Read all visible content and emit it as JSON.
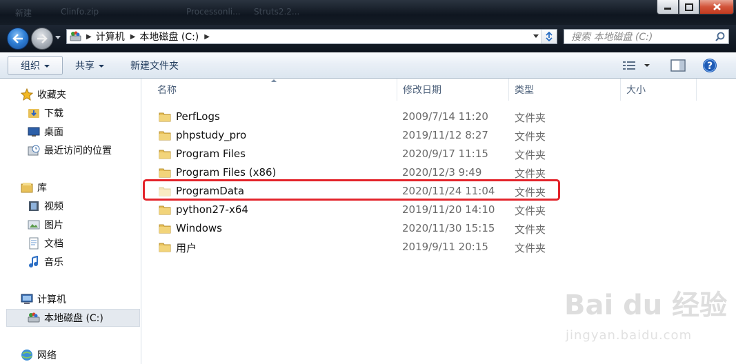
{
  "titlebar": {
    "ghost_tabs": [
      "新建",
      "Clinfo.zip",
      "Processonli...",
      "Struts2.2..."
    ]
  },
  "address": {
    "crumbs": [
      "计算机",
      "本地磁盘 (C:)"
    ]
  },
  "search": {
    "placeholder": "搜索 本地磁盘 (C:)"
  },
  "toolbar": {
    "organize": "组织",
    "share": "共享",
    "new_folder": "新建文件夹"
  },
  "sidebar": {
    "favorites": "收藏夹",
    "downloads": "下载",
    "desktop": "桌面",
    "recent": "最近访问的位置",
    "libraries": "库",
    "videos": "视频",
    "pictures": "图片",
    "documents": "文档",
    "music": "音乐",
    "computer": "计算机",
    "local_disk": "本地磁盘 (C:)",
    "network": "网络"
  },
  "columns": {
    "name": "名称",
    "date": "修改日期",
    "type": "类型",
    "size": "大小"
  },
  "files": [
    {
      "name": "PerfLogs",
      "date": "2009/7/14 11:20",
      "type": "文件夹"
    },
    {
      "name": "phpstudy_pro",
      "date": "2019/11/12 8:27",
      "type": "文件夹"
    },
    {
      "name": "Program Files",
      "date": "2020/9/17 11:15",
      "type": "文件夹"
    },
    {
      "name": "Program Files (x86)",
      "date": "2020/12/3 9:49",
      "type": "文件夹"
    },
    {
      "name": "ProgramData",
      "date": "2020/11/24 11:04",
      "type": "文件夹"
    },
    {
      "name": "python27-x64",
      "date": "2019/11/20 14:10",
      "type": "文件夹"
    },
    {
      "name": "Windows",
      "date": "2020/11/30 15:15",
      "type": "文件夹"
    },
    {
      "name": "用户",
      "date": "2019/9/11 20:15",
      "type": "文件夹"
    }
  ],
  "watermark": {
    "logo": "Bai du 经验",
    "url": "jingyan.baidu.com"
  },
  "colors": {
    "highlight": "#e3232a",
    "folder": "#e8c15a",
    "toolbar_text": "#1e395b"
  }
}
